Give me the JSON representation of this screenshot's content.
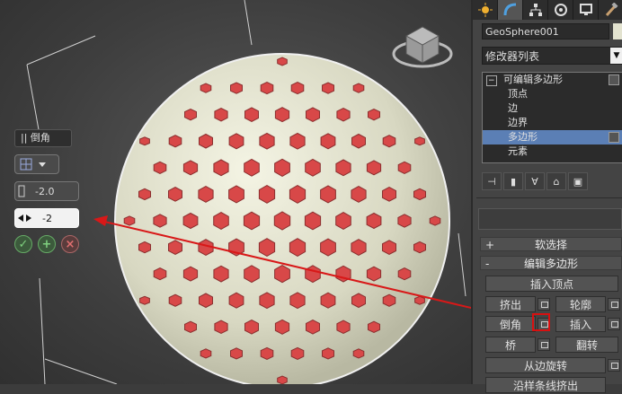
{
  "caddy": {
    "title": "|| 倒角",
    "value1": "-2.0",
    "value2": "-2"
  },
  "panel": {
    "object_name": "GeoSphere001",
    "modifier_list": "修改器列表",
    "stack": [
      "可编辑多边形",
      "顶点",
      "边",
      "边界",
      "多边形",
      "元素"
    ],
    "rollouts": {
      "soft_select": "软选择",
      "edit_poly": "编辑多边形",
      "soft_pm": "+",
      "edit_pm": "-"
    },
    "buttons": {
      "insert_vertex": "插入顶点",
      "extrude": "挤出",
      "outline": "轮廓",
      "bevel": "倒角",
      "inset": "插入",
      "bridge": "桥",
      "flip": "翻转",
      "hinge": "从边旋转",
      "extrude_spline": "沿样条线挤出"
    }
  },
  "colors": {
    "sphere": "#e4e4cf",
    "hole": "#d84848",
    "arrow": "#d81818",
    "selection": "#5b7fb5"
  }
}
